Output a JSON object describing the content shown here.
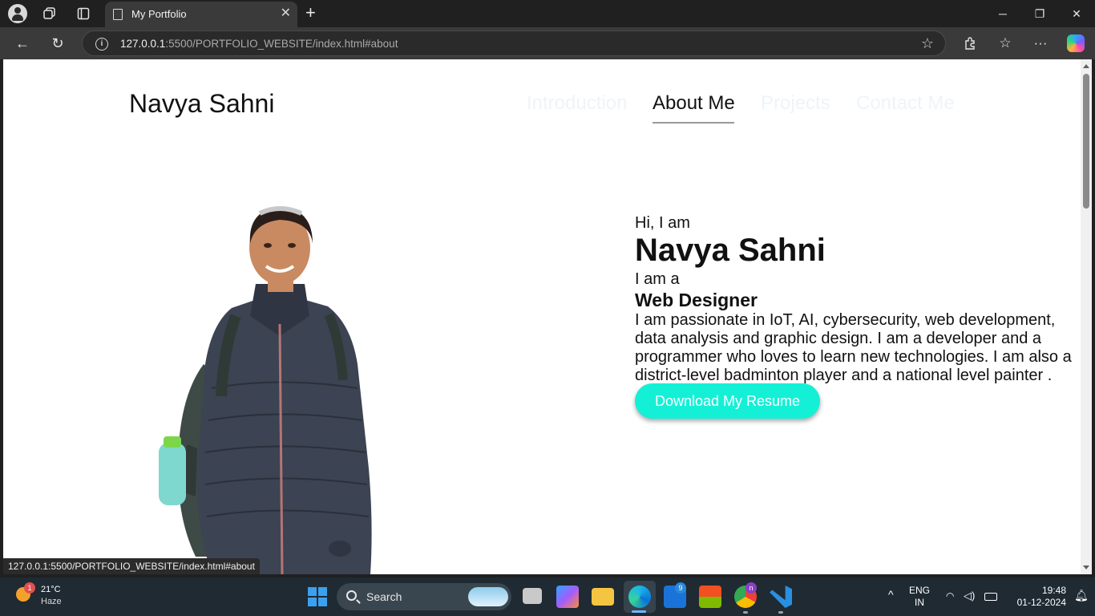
{
  "browser": {
    "tab_title": "My Portfolio",
    "url_host": "127.0.0.1",
    "url_rest": ":5500/PORTFOLIO_WEBSITE/index.html#about",
    "status_url": "127.0.0.1:5500/PORTFOLIO_WEBSITE/index.html#about"
  },
  "page": {
    "logo": "Navya Sahni",
    "nav": [
      {
        "label": "Introduction",
        "active": false
      },
      {
        "label": "About Me",
        "active": true
      },
      {
        "label": "Projects",
        "active": false
      },
      {
        "label": "Contact Me",
        "active": false
      }
    ],
    "greeting": "Hi, I am",
    "name": "Navya Sahni",
    "role_prefix": "I am a",
    "role": "Web Designer",
    "description": "I am passionate in IoT, AI, cybersecurity, web development, data analysis and graphic design. I am a developer and a programmer who loves to learn new technologies. I am also a district-level badminton player and a national level painter .",
    "resume_button": "Download My Resume",
    "colors": {
      "accent": "#14f0d6",
      "inactive_nav": "#eef4f8"
    }
  },
  "taskbar": {
    "weather_temp": "21°C",
    "weather_cond": "Haze",
    "weather_badge": "1",
    "search_label": "Search",
    "outlook_badge": "9",
    "chrome_badge": "n",
    "lang": "ENG",
    "region": "IN",
    "time": "19:48",
    "date": "01-12-2024"
  }
}
